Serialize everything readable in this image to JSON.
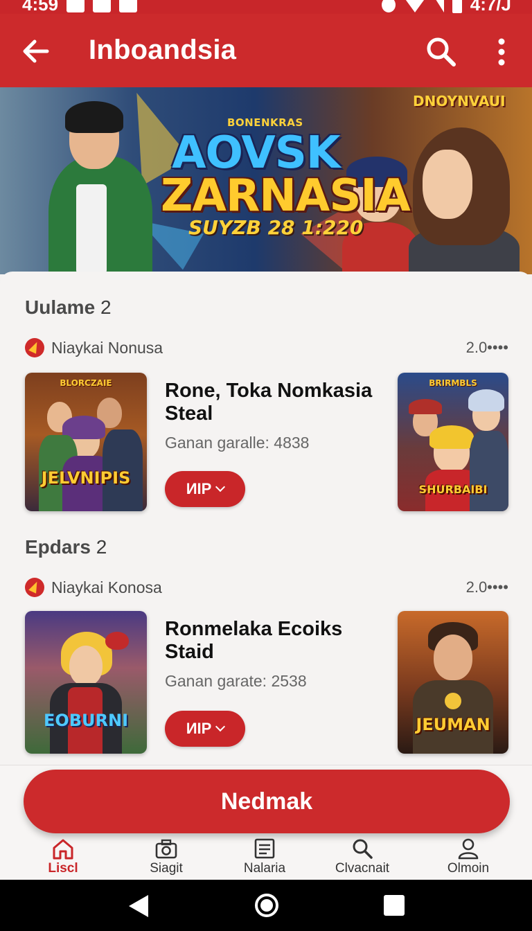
{
  "status_bar": {
    "time": "4:59",
    "battery_text": "4:7/J"
  },
  "app_bar": {
    "title": "Inboandsia"
  },
  "banner": {
    "badge": "DNOYNVAUI",
    "subtitle_top": "BONENKRAS",
    "title_line1": "AOVSK",
    "title_line2": "ZARNASIA",
    "title_line3": "SUYZB 28 1:220"
  },
  "sections": [
    {
      "title": "Uulame",
      "count": "2",
      "source": "Niaykai Nonusa",
      "version": "2.0••••",
      "item": {
        "title": "Rone, Toka Nomkasia Steal",
        "meta": "Ganan garalle: 4838",
        "chip_label": "ИIP",
        "thumb_left_top": "BLORCZAIE",
        "thumb_left_label": "JELVNIPIS",
        "thumb_right_top": "BRIRMBLS",
        "thumb_right_label": "SHURBAIBI"
      }
    },
    {
      "title": "Epdars",
      "count": "2",
      "source": "Niaykai Konosa",
      "version": "2.0••••",
      "item": {
        "title": "Ronmelaka Ecoiks Staid",
        "meta": "Ganan garate: 2538",
        "chip_label": "ИIP",
        "thumb_left_label": "EOBURNI",
        "thumb_right_label": "JEUMAN"
      }
    }
  ],
  "cta": {
    "label": "Nedmak"
  },
  "bottom_nav": [
    {
      "label": "Liscl",
      "icon": "home-icon",
      "active": true
    },
    {
      "label": "Siagit",
      "icon": "camera-icon",
      "active": false
    },
    {
      "label": "Nalaria",
      "icon": "list-icon",
      "active": false
    },
    {
      "label": "Clvacnait",
      "icon": "search-icon",
      "active": false
    },
    {
      "label": "Olmoin",
      "icon": "profile-icon",
      "active": false
    }
  ],
  "colors": {
    "brand_red": "#cc2a2c",
    "accent_yellow": "#ffcb2e"
  }
}
